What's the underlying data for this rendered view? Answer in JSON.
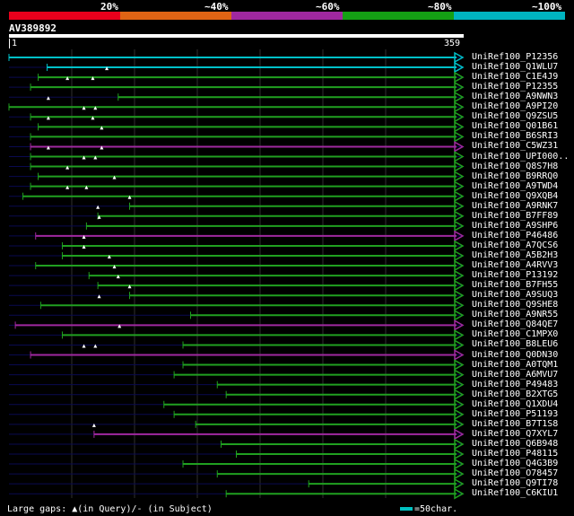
{
  "legend": [
    {
      "label": "20%",
      "color": "#e8001c"
    },
    {
      "label": "~40%",
      "color": "#e06414"
    },
    {
      "label": "~60%",
      "color": "#a028a0"
    },
    {
      "label": "~80%",
      "color": "#14a014"
    },
    {
      "label": "~100%",
      "color": "#00b4c0"
    }
  ],
  "query": {
    "name": "AV389892",
    "start": "1",
    "end": "359"
  },
  "hits": [
    {
      "name": "UniRef100_P12356",
      "color": "cyan",
      "start": 1,
      "gaps": []
    },
    {
      "name": "UniRef100_Q1WLU7",
      "color": "cyan",
      "start": 31,
      "gaps": []
    },
    {
      "name": "UniRef100_C1E4J9",
      "color": "green",
      "start": 24,
      "gaps": [
        78
      ]
    },
    {
      "name": "UniRef100_P12355",
      "color": "green",
      "start": 18,
      "gaps": [
        47,
        67
      ]
    },
    {
      "name": "UniRef100_A9NWN3",
      "color": "green",
      "start": 87,
      "gaps": []
    },
    {
      "name": "UniRef100_A9PI20",
      "color": "green",
      "start": 1,
      "gaps": [
        32
      ]
    },
    {
      "name": "UniRef100_Q9ZSU5",
      "color": "green",
      "start": 18,
      "gaps": [
        60,
        69
      ]
    },
    {
      "name": "UniRef100_Q01B61",
      "color": "green",
      "start": 24,
      "gaps": [
        32,
        67
      ]
    },
    {
      "name": "UniRef100_B6SRI3",
      "color": "green",
      "start": 18,
      "gaps": [
        74
      ]
    },
    {
      "name": "UniRef100_C5WZ31",
      "color": "purple",
      "start": 18,
      "gaps": []
    },
    {
      "name": "UniRef100_UPI000..",
      "color": "green",
      "start": 18,
      "gaps": [
        32,
        74
      ]
    },
    {
      "name": "UniRef100_Q8S7H8",
      "color": "green",
      "start": 18,
      "gaps": [
        60,
        69
      ]
    },
    {
      "name": "UniRef100_B9RRQ0",
      "color": "green",
      "start": 24,
      "gaps": [
        47
      ]
    },
    {
      "name": "UniRef100_A9TWD4",
      "color": "green",
      "start": 18,
      "gaps": [
        84
      ]
    },
    {
      "name": "UniRef100_Q9XQB4",
      "color": "green",
      "start": 12,
      "gaps": [
        47,
        62
      ]
    },
    {
      "name": "UniRef100_A9RNK7",
      "color": "green",
      "start": 96,
      "gaps": [
        96
      ]
    },
    {
      "name": "UniRef100_B7FF89",
      "color": "green",
      "start": 71,
      "gaps": [
        71
      ]
    },
    {
      "name": "UniRef100_A9SHP6",
      "color": "green",
      "start": 62,
      "gaps": [
        72
      ]
    },
    {
      "name": "UniRef100_P46486",
      "color": "purple",
      "start": 22,
      "gaps": []
    },
    {
      "name": "UniRef100_A7QCS6",
      "color": "green",
      "start": 43,
      "gaps": [
        60
      ]
    },
    {
      "name": "UniRef100_A5B2H3",
      "color": "green",
      "start": 43,
      "gaps": [
        60
      ]
    },
    {
      "name": "UniRef100_A4RVV3",
      "color": "green",
      "start": 22,
      "gaps": [
        80
      ]
    },
    {
      "name": "UniRef100_P13192",
      "color": "green",
      "start": 64,
      "gaps": [
        84
      ]
    },
    {
      "name": "UniRef100_B7FH55",
      "color": "green",
      "start": 71,
      "gaps": [
        87
      ]
    },
    {
      "name": "UniRef100_A9SUQ3",
      "color": "green",
      "start": 96,
      "gaps": [
        96
      ]
    },
    {
      "name": "UniRef100_Q9SHE8",
      "color": "green",
      "start": 26,
      "gaps": [
        72
      ]
    },
    {
      "name": "UniRef100_A9NR55",
      "color": "green",
      "start": 144,
      "gaps": []
    },
    {
      "name": "UniRef100_Q84QE7",
      "color": "purple",
      "start": 6,
      "gaps": []
    },
    {
      "name": "UniRef100_C1MPX0",
      "color": "green",
      "start": 43,
      "gaps": [
        88
      ]
    },
    {
      "name": "UniRef100_B8LEU6",
      "color": "green",
      "start": 138,
      "gaps": []
    },
    {
      "name": "UniRef100_Q0DN30",
      "color": "purple",
      "start": 18,
      "gaps": [
        60,
        69
      ]
    },
    {
      "name": "UniRef100_A0TQM1",
      "color": "green",
      "start": 138,
      "gaps": []
    },
    {
      "name": "UniRef100_A6MVU7",
      "color": "green",
      "start": 131,
      "gaps": []
    },
    {
      "name": "UniRef100_P49483",
      "color": "green",
      "start": 165,
      "gaps": []
    },
    {
      "name": "UniRef100_B2XTG5",
      "color": "green",
      "start": 172,
      "gaps": []
    },
    {
      "name": "UniRef100_Q1XDU4",
      "color": "green",
      "start": 123,
      "gaps": []
    },
    {
      "name": "UniRef100_P51193",
      "color": "green",
      "start": 131,
      "gaps": []
    },
    {
      "name": "UniRef100_B7T1S8",
      "color": "green",
      "start": 148,
      "gaps": []
    },
    {
      "name": "UniRef100_Q7XYL7",
      "color": "purple",
      "start": 68,
      "gaps": [
        68
      ]
    },
    {
      "name": "UniRef100_Q6B948",
      "color": "green",
      "start": 168,
      "gaps": []
    },
    {
      "name": "UniRef100_P48115",
      "color": "green",
      "start": 180,
      "gaps": []
    },
    {
      "name": "UniRef100_Q4G3B9",
      "color": "green",
      "start": 138,
      "gaps": []
    },
    {
      "name": "UniRef100_O78457",
      "color": "green",
      "start": 165,
      "gaps": []
    },
    {
      "name": "UniRef100_Q9TI78",
      "color": "green",
      "start": 237,
      "gaps": []
    },
    {
      "name": "UniRef100_C6KIU1",
      "color": "green",
      "start": 172,
      "gaps": []
    }
  ],
  "colors": {
    "cyan": "#00c0c8",
    "green": "#20a020",
    "purple": "#a028a0",
    "navy": "#0a0a50",
    "grid": "#303030"
  },
  "footer": {
    "text": "Large gaps: ▲(in Query)/- (in Subject)",
    "scale": "=50char."
  }
}
